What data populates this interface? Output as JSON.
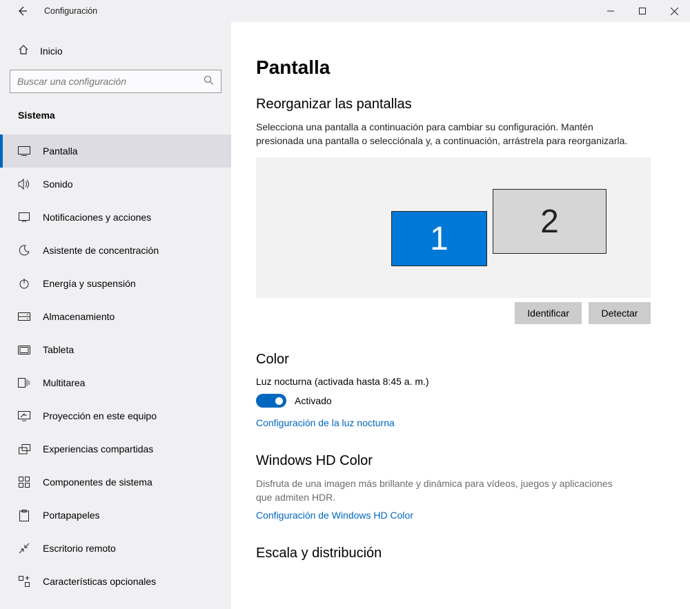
{
  "titlebar": {
    "title": "Configuración"
  },
  "sidebar": {
    "home": "Inicio",
    "search_placeholder": "Buscar una configuración",
    "section": "Sistema",
    "items": [
      {
        "label": "Pantalla",
        "icon": "display",
        "active": true
      },
      {
        "label": "Sonido",
        "icon": "sound"
      },
      {
        "label": "Notificaciones y acciones",
        "icon": "notif"
      },
      {
        "label": "Asistente de concentración",
        "icon": "moon"
      },
      {
        "label": "Energía y suspensión",
        "icon": "power"
      },
      {
        "label": "Almacenamiento",
        "icon": "storage"
      },
      {
        "label": "Tableta",
        "icon": "tablet"
      },
      {
        "label": "Multitarea",
        "icon": "multitask"
      },
      {
        "label": "Proyección en este equipo",
        "icon": "project"
      },
      {
        "label": "Experiencias compartidas",
        "icon": "shared"
      },
      {
        "label": "Componentes de sistema",
        "icon": "components"
      },
      {
        "label": "Portapapeles",
        "icon": "clipboard"
      },
      {
        "label": "Escritorio remoto",
        "icon": "remote"
      },
      {
        "label": "Características opcionales",
        "icon": "optional"
      }
    ]
  },
  "main": {
    "page_title": "Pantalla",
    "rearrange": {
      "heading": "Reorganizar las pantallas",
      "desc": "Selecciona una pantalla a continuación para cambiar su configuración. Mantén presionada una pantalla o selecciónala y, a continuación, arrástrela para reorganizarla.",
      "monitor1": "1",
      "monitor2": "2",
      "identify": "Identificar",
      "detect": "Detectar"
    },
    "color": {
      "heading": "Color",
      "night_label": "Luz nocturna (activada hasta 8:45 a. m.)",
      "toggle_state": "Activado",
      "night_link": "Configuración de la luz nocturna"
    },
    "hd": {
      "heading": "Windows HD Color",
      "desc": "Disfruta de una imagen más brillante y dinámica para vídeos, juegos y aplicaciones que admiten HDR.",
      "link": "Configuración de Windows HD Color"
    },
    "scale": {
      "heading": "Escala y distribución"
    }
  }
}
